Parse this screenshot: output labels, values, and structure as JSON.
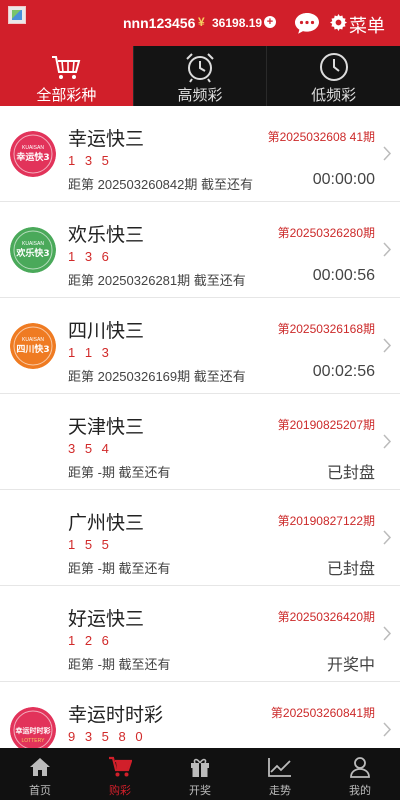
{
  "header": {
    "username": "nnn123456",
    "currency_symbol": "¥",
    "balance": "36198.19",
    "add_symbol": "+",
    "menu_label": "菜单"
  },
  "tabs": [
    {
      "label": "全部彩种",
      "icon": "basket-icon",
      "active": true
    },
    {
      "label": "高频彩",
      "icon": "alarm-clock-icon",
      "active": false
    },
    {
      "label": "低频彩",
      "icon": "clock-icon",
      "active": false
    }
  ],
  "lotteries": [
    {
      "name": "幸运快三",
      "period": "第2025032608 41期",
      "numbers": "1 3 5",
      "next": "距第 202503260842期 截至还有",
      "status": "00:00:00",
      "logo_text": "幸运快3",
      "logo_color": "#e2335a"
    },
    {
      "name": "欢乐快三",
      "period": "第20250326280期",
      "numbers": "1 3 6",
      "next": "距第 20250326281期 截至还有",
      "status": "00:00:56",
      "logo_text": "欢乐快3",
      "logo_color": "#4aa95a"
    },
    {
      "name": "四川快三",
      "period": "第20250326168期",
      "numbers": "1 1 3",
      "next": "距第 20250326169期 截至还有",
      "status": "00:02:56",
      "logo_text": "四川快3",
      "logo_color": "#ef7b22"
    },
    {
      "name": "天津快三",
      "period": "第20190825207期",
      "numbers": "3 5 4",
      "next": "距第 -期 截至还有",
      "status": "已封盘",
      "logo_text": "",
      "logo_color": ""
    },
    {
      "name": "广州快三",
      "period": "第20190827122期",
      "numbers": "1 5 5",
      "next": "距第 -期 截至还有",
      "status": "已封盘",
      "logo_text": "",
      "logo_color": ""
    },
    {
      "name": "好运快三",
      "period": "第20250326420期",
      "numbers": "1 2 6",
      "next": "距第 -期 截至还有",
      "status": "开奖中",
      "logo_text": "",
      "logo_color": ""
    },
    {
      "name": "幸运时时彩",
      "period": "第202503260841期",
      "numbers": "9 3 5 8 0",
      "next": "",
      "status": "",
      "logo_text": "幸运时时彩",
      "logo_color": "#e2335a"
    }
  ],
  "bottom_nav": [
    {
      "label": "首页",
      "icon": "home-icon",
      "active": false
    },
    {
      "label": "购彩",
      "icon": "cart-icon",
      "active": true
    },
    {
      "label": "开奖",
      "icon": "gift-icon",
      "active": false
    },
    {
      "label": "走势",
      "icon": "trend-chart-icon",
      "active": false
    },
    {
      "label": "我的",
      "icon": "user-icon",
      "active": false
    }
  ],
  "colors": {
    "brand_red": "#d11f2a",
    "dark_bar": "#141414",
    "number_red": "#d12a2a"
  }
}
